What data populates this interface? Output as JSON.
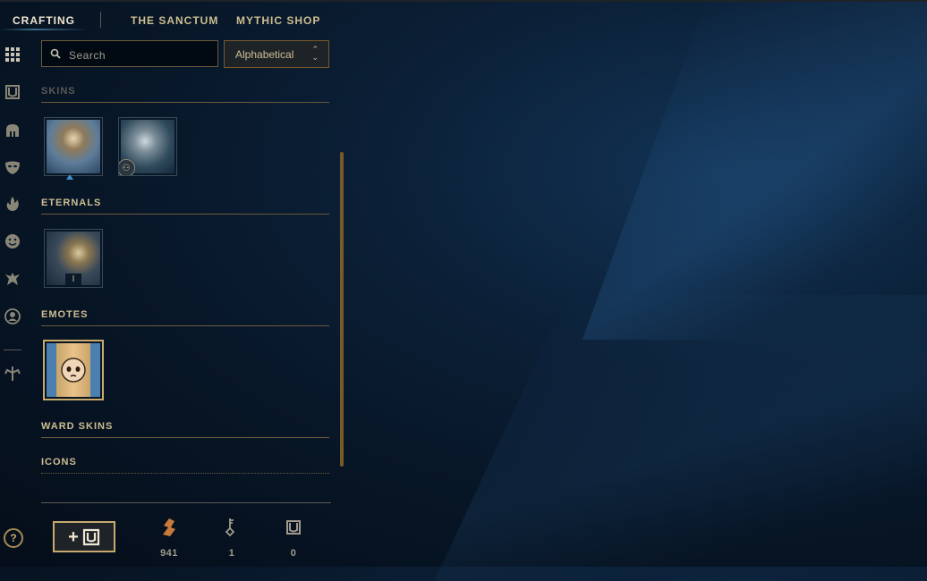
{
  "tabs": [
    {
      "label": "CRAFTING"
    },
    {
      "label": "THE SANCTUM"
    },
    {
      "label": "MYTHIC SHOP"
    }
  ],
  "sidebar": {
    "icons": [
      "grid-icon",
      "chest-icon",
      "helmet-icon",
      "mask-icon",
      "flame-icon",
      "emote-icon",
      "ward-icon",
      "summoner-icon",
      "branch-icon"
    ],
    "help_label": "?"
  },
  "search": {
    "placeholder": "Search"
  },
  "sort": {
    "selected": "Alphabetical"
  },
  "sections": {
    "skins": {
      "title": "SKINS"
    },
    "eternals": {
      "title": "ETERNALS",
      "item_count": "I"
    },
    "emotes": {
      "title": "EMOTES"
    },
    "ward_skins": {
      "title": "WARD SKINS"
    },
    "icons": {
      "title": "ICONS"
    }
  },
  "currencies": [
    {
      "name": "orange-essence-icon",
      "value": "941"
    },
    {
      "name": "key-icon",
      "value": "1"
    },
    {
      "name": "chest-icon",
      "value": "0"
    }
  ],
  "colors": {
    "gold": "#c8aa6e",
    "text": "#cdbe91",
    "bg": "#0b1f36",
    "accent_blue": "#3f8fc8",
    "orange": "#c97a3a"
  }
}
